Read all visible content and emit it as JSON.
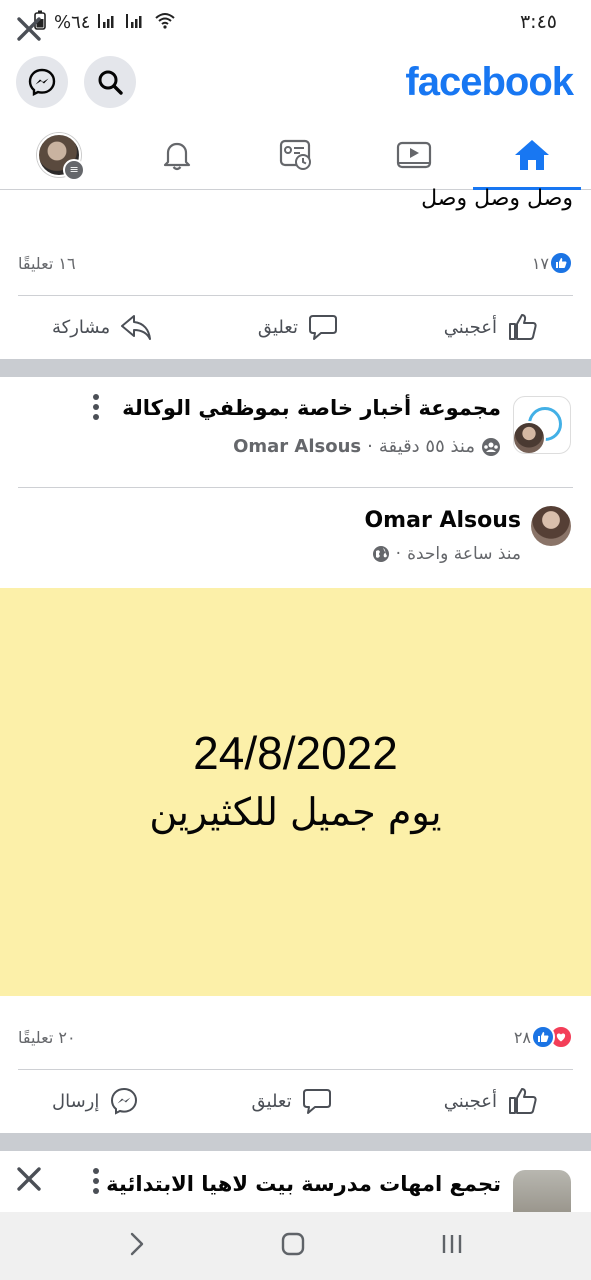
{
  "status_bar": {
    "time": "٣:٤٥",
    "battery": "%٦٤",
    "icons": [
      "battery-icon",
      "signal-icon",
      "signal-icon",
      "wifi-icon"
    ]
  },
  "header": {
    "logo": "facebook",
    "brand_color": "#1877f2",
    "buttons": [
      "messenger-icon",
      "search-icon"
    ]
  },
  "nav": {
    "tabs": [
      "home",
      "watch",
      "feeds",
      "notifications",
      "profile-menu"
    ],
    "active": "home"
  },
  "post1": {
    "text": "وصل وصل وصل",
    "likes": "١٧",
    "comments": "١٦ تعليقًا",
    "actions": {
      "like": "أعجبني",
      "comment": "تعليق",
      "share": "مشاركة"
    }
  },
  "post2": {
    "group_name": "مجموعة أخبار خاصة بموظفي الوكالة",
    "time": "منذ ٥٥ دقيقة",
    "shared_by": "Omar Alsous",
    "author": "Omar Alsous",
    "author_time": "منذ ساعة واحدة",
    "date_text": "24/8/2022",
    "body_text": "يوم جميل للكثيرين",
    "background": "#fcf0a9",
    "reactions": "٢٨",
    "comments": "٢٠ تعليقًا",
    "actions": {
      "like": "أعجبني",
      "comment": "تعليق",
      "send": "إرسال"
    }
  },
  "post3": {
    "group_name": "تجمع امهات مدرسة بيت لاهيا الابتدائية"
  },
  "system_nav": [
    "back-icon",
    "home-icon",
    "recents-icon"
  ]
}
